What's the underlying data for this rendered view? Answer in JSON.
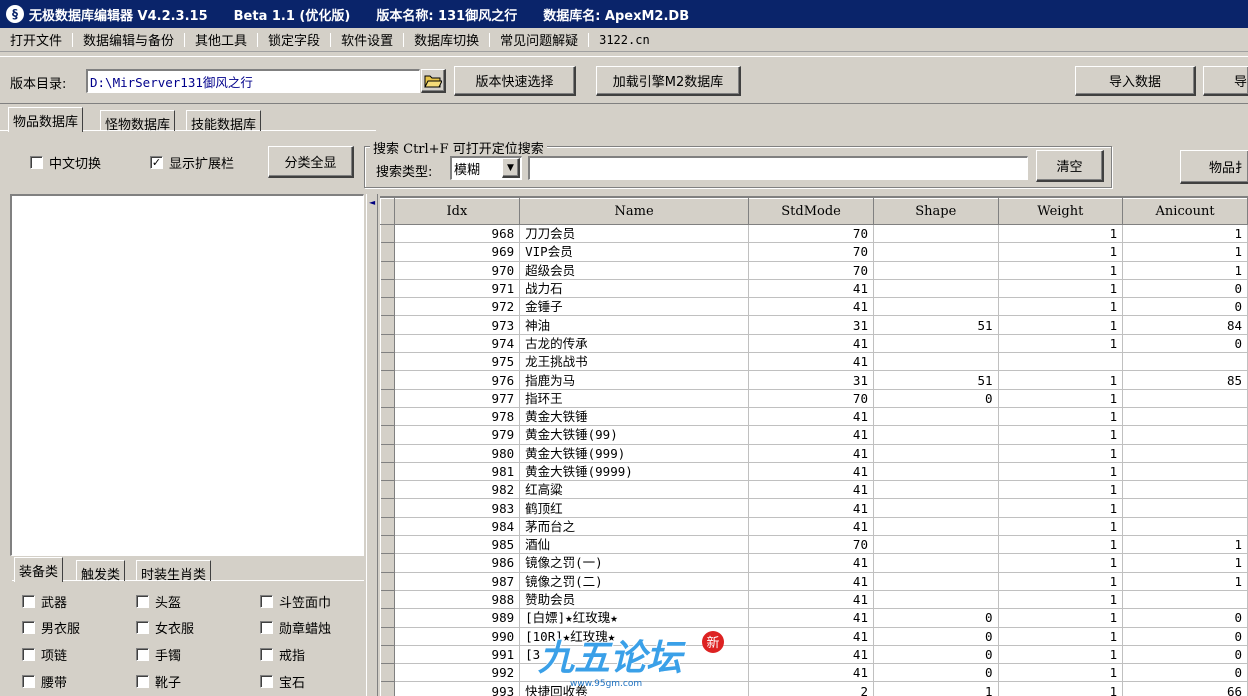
{
  "window": {
    "title_parts": [
      "无极数据库编辑器 V4.2.3.15",
      "Beta 1.1 (优化版)",
      "版本名称: 131御风之行",
      "数据库名: ApexM2.DB"
    ]
  },
  "menu": [
    "打开文件",
    "数据编辑与备份",
    "其他工具",
    "锁定字段",
    "软件设置",
    "数据库切换",
    "常见问题解疑",
    "3122.cn"
  ],
  "pathbar": {
    "label": "版本目录:",
    "path_value": "D:\\MirServer131御风之行",
    "quick_select": "版本快速选择",
    "load_engine": "加载引擎M2数据库",
    "import": "导入数据",
    "export_partial": "导"
  },
  "main_tabs": [
    "物品数据库",
    "怪物数据库",
    "技能数据库"
  ],
  "filters": {
    "chinese_switch": "中文切换",
    "chinese_switch_checked": false,
    "show_ext": "显示扩展栏",
    "show_ext_checked": true,
    "show_all_cats": "分类全显"
  },
  "search": {
    "group_title": "搜索  Ctrl+F 可打开定位搜索",
    "type_label": "搜索类型:",
    "type_value": "模糊",
    "query": "",
    "clear": "清空",
    "item_btn_partial": "物品扌"
  },
  "category_tabs": [
    "装备类",
    "触发类",
    "时装生肖类"
  ],
  "categories": [
    [
      "武器",
      "头盔",
      "斗笠面巾"
    ],
    [
      "男衣服",
      "女衣服",
      "勋章蜡烛"
    ],
    [
      "项链",
      "手镯",
      "戒指"
    ],
    [
      "腰带",
      "靴子",
      "宝石"
    ]
  ],
  "table": {
    "columns": [
      "Idx",
      "Name",
      "StdMode",
      "Shape",
      "Weight",
      "Anicount"
    ],
    "rows": [
      [
        "968",
        "刀刀会员",
        "70",
        "",
        "1",
        "1"
      ],
      [
        "969",
        "VIP会员",
        "70",
        "",
        "1",
        "1"
      ],
      [
        "970",
        "超级会员",
        "70",
        "",
        "1",
        "1"
      ],
      [
        "971",
        "战力石",
        "41",
        "",
        "1",
        "0"
      ],
      [
        "972",
        "金锤子",
        "41",
        "",
        "1",
        "0"
      ],
      [
        "973",
        "神油",
        "31",
        "51",
        "1",
        "84"
      ],
      [
        "974",
        "古龙的传承",
        "41",
        "",
        "1",
        "0"
      ],
      [
        "975",
        "龙王挑战书",
        "41",
        "",
        "",
        ""
      ],
      [
        "976",
        "指鹿为马",
        "31",
        "51",
        "1",
        "85"
      ],
      [
        "977",
        "指环王",
        "70",
        "0",
        "1",
        ""
      ],
      [
        "978",
        "黄金大铁锤",
        "41",
        "",
        "1",
        ""
      ],
      [
        "979",
        "黄金大铁锤(99)",
        "41",
        "",
        "1",
        ""
      ],
      [
        "980",
        "黄金大铁锤(999)",
        "41",
        "",
        "1",
        ""
      ],
      [
        "981",
        "黄金大铁锤(9999)",
        "41",
        "",
        "1",
        ""
      ],
      [
        "982",
        "红高粱",
        "41",
        "",
        "1",
        ""
      ],
      [
        "983",
        "鹤顶红",
        "41",
        "",
        "1",
        ""
      ],
      [
        "984",
        "茅而台之",
        "41",
        "",
        "1",
        ""
      ],
      [
        "985",
        "酒仙",
        "70",
        "",
        "1",
        "1"
      ],
      [
        "986",
        "镜像之罚(一)",
        "41",
        "",
        "1",
        "1"
      ],
      [
        "987",
        "镜像之罚(二)",
        "41",
        "",
        "1",
        "1"
      ],
      [
        "988",
        "赞助会员",
        "41",
        "",
        "1",
        ""
      ],
      [
        "989",
        "[白嫖]★红玫瑰★",
        "41",
        "0",
        "1",
        "0"
      ],
      [
        "990",
        "[10R]★红玫瑰★",
        "41",
        "0",
        "1",
        "0"
      ],
      [
        "991",
        "[3",
        "41",
        "0",
        "1",
        "0"
      ],
      [
        "992",
        "",
        "41",
        "0",
        "1",
        "0"
      ],
      [
        "993",
        "快捷回收卷",
        "2",
        "1",
        "1",
        "66"
      ]
    ]
  },
  "watermark": {
    "text": "九五论坛",
    "sub": "www.95gm.com",
    "badge": "新"
  }
}
